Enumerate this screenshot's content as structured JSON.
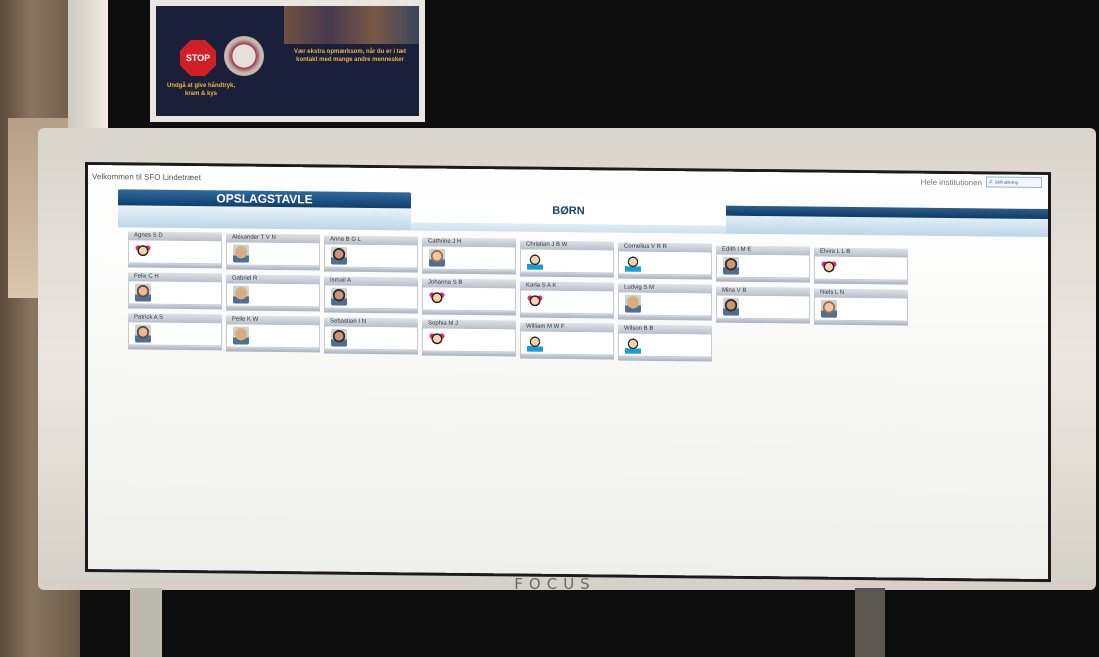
{
  "screen": {
    "welcome_text": "Velkommen til SFO Lindetræet",
    "tabs": [
      {
        "label": "OPSLAGSTAVLE",
        "active": false
      },
      {
        "label": "BØRN",
        "active": true
      }
    ],
    "scope_label": "Hele institutionen",
    "scope_button_label": "Skift afdeling"
  },
  "environment": {
    "brand": "FOCUS",
    "poster_stop": "STOP",
    "poster_text_1": "Undgå at give håndtryk, kram & kys",
    "poster_text_2": "Vær ekstra opmærksom, når du er i tæt kontakt med mange andre mennesker"
  },
  "children": [
    [
      "Agnes S D",
      "cartoon-girl-icon"
    ],
    [
      "Alexander T V N",
      "child-photo"
    ],
    [
      "Anna B G L",
      "child-photo"
    ],
    [
      "Cathrine J H",
      "child-photo"
    ],
    [
      "Christian J B W",
      "cartoon-boy-icon"
    ],
    [
      "Cornelius V R R",
      "cartoon-boy-icon"
    ],
    [
      "Edith I M E",
      "child-photo"
    ],
    [
      "Elvira L L B",
      "cartoon-girl-icon"
    ],
    [
      "Felix C H",
      "child-photo"
    ],
    [
      "Gabriel R",
      "child-photo"
    ],
    [
      "Ismail A",
      "child-photo"
    ],
    [
      "Johanna S B",
      "cartoon-girl-icon"
    ],
    [
      "Karla S A K",
      "cartoon-girl-icon"
    ],
    [
      "Ludvig S M",
      "child-photo"
    ],
    [
      "Mina V B",
      "child-photo"
    ],
    [
      "Niels L N",
      "child-photo"
    ],
    [
      "Patrick A S",
      "child-photo"
    ],
    [
      "Pelle K W",
      "child-photo"
    ],
    [
      "Sebastian I N",
      "child-photo"
    ],
    [
      "Sophia M J",
      "cartoon-girl-icon"
    ],
    [
      "William M W F",
      "cartoon-boy-icon"
    ],
    [
      "Wilson B B",
      "cartoon-boy-icon"
    ]
  ]
}
